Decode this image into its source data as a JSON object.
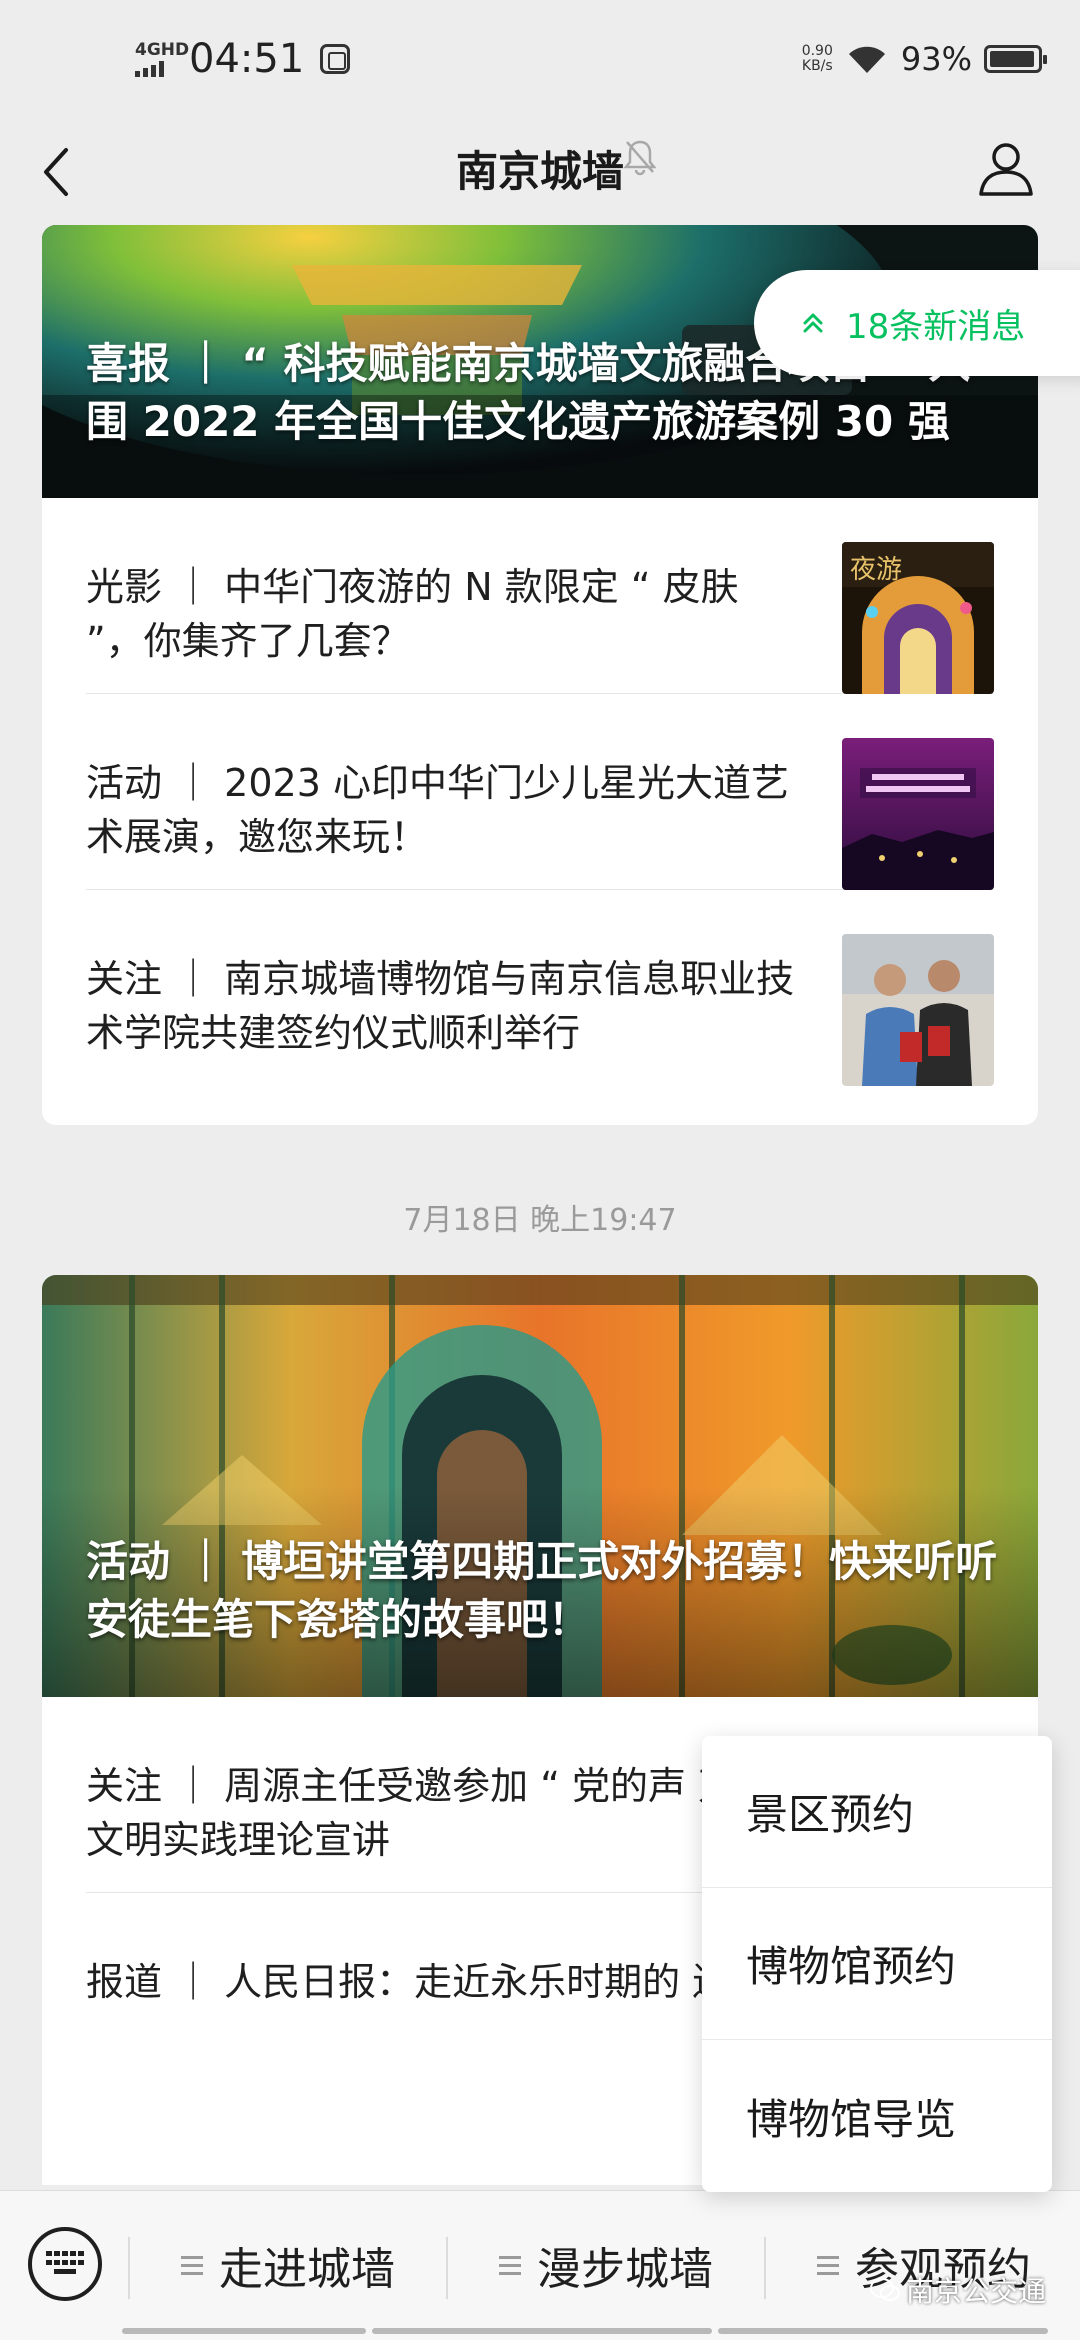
{
  "status_bar": {
    "network": "4GHD",
    "time": "04:51",
    "speed_value": "0.90",
    "speed_unit": "KB/s",
    "battery": "93%"
  },
  "nav": {
    "title": "南京城墙"
  },
  "new_messages": {
    "label": "18条新消息"
  },
  "card1": {
    "hero_title": "喜报 ｜ “ 科技赋能南京城墙文旅融合项目 ” 入围 2022 年全国十佳文化遗产旅游案例 30 强",
    "articles": [
      {
        "title": "光影 ｜ 中华门夜游的 N 款限定 “ 皮肤 ”，你集齐了几套？"
      },
      {
        "title": "活动 ｜ 2023 心印中华门少儿星光大道艺术展演，邀您来玩！"
      },
      {
        "title": "关注 ｜ 南京城墙博物馆与南京信息职业技术学院共建签约仪式顺利举行"
      }
    ]
  },
  "timestamp": "7月18日 晚上19:47",
  "card2": {
    "hero_title": "活动 ｜ 博垣讲堂第四期正式对外招募！快来听听安徒生笔下瓷塔的故事吧！",
    "articles": [
      {
        "title": "关注 ｜ 周源主任受邀参加 “ 党的声 万家 ” 文明实践理论宣讲"
      },
      {
        "title": "报道 ｜ 人民日报：走近永乐时期的 遗产"
      }
    ]
  },
  "popup_menu": {
    "items": [
      "景区预约",
      "博物馆预约",
      "博物馆导览"
    ]
  },
  "bottom_menu": {
    "items": [
      "走进城墙",
      "漫步城墙",
      "参观预约"
    ]
  },
  "watermark": "南京公交通",
  "colors": {
    "accent_green": "#07c160",
    "background": "#ededed"
  }
}
